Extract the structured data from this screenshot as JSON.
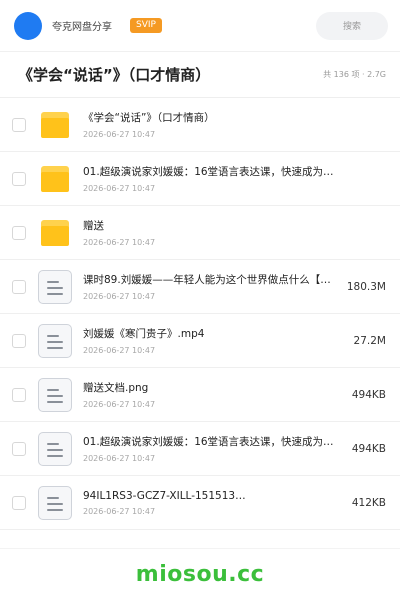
{
  "header": {
    "app_name": "夸克网盘分享",
    "badge": "SVIP",
    "search_placeholder": "搜索"
  },
  "folder": {
    "title": "《学会“说话”》（口才情商）",
    "summary": "共 136 项 · 2.7G"
  },
  "items": [
    {
      "type": "folder",
      "name": "《学会“说话”》（口才情商）",
      "date": "2026-06-27 10:47",
      "size": ""
    },
    {
      "type": "folder",
      "name": "01.超级演说家刘媛媛：16堂语言表达课，快速成为…",
      "date": "2026-06-27 10:47",
      "size": ""
    },
    {
      "type": "folder",
      "name": "赠送",
      "date": "2026-06-27 10:47",
      "size": ""
    },
    {
      "type": "file",
      "name": "课时89.刘媛媛——年轻人能为这个世界做点什么【公…",
      "date": "2026-06-27 10:47",
      "size": "180.3M"
    },
    {
      "type": "file",
      "name": "刘媛媛《寒门贵子》.mp4",
      "date": "2026-06-27 10:47",
      "size": "27.2M"
    },
    {
      "type": "file",
      "name": "赠送文档.png",
      "date": "2026-06-27 10:47",
      "size": "494KB"
    },
    {
      "type": "file",
      "name": "01.超级演说家刘媛媛：16堂语言表达课，快速成为…",
      "date": "2026-06-27 10:47",
      "size": "494KB"
    },
    {
      "type": "file",
      "name": "94IL1RS3-GCZ7-XILL-151513…",
      "date": "2026-06-27 10:47",
      "size": "412KB"
    }
  ],
  "footer": {
    "site": "miosou.cc"
  },
  "colors": {
    "accent": "#1f7bf2",
    "badge": "#f59a23",
    "folder": "#ffc21a",
    "watermark": "#3bbf3b"
  }
}
